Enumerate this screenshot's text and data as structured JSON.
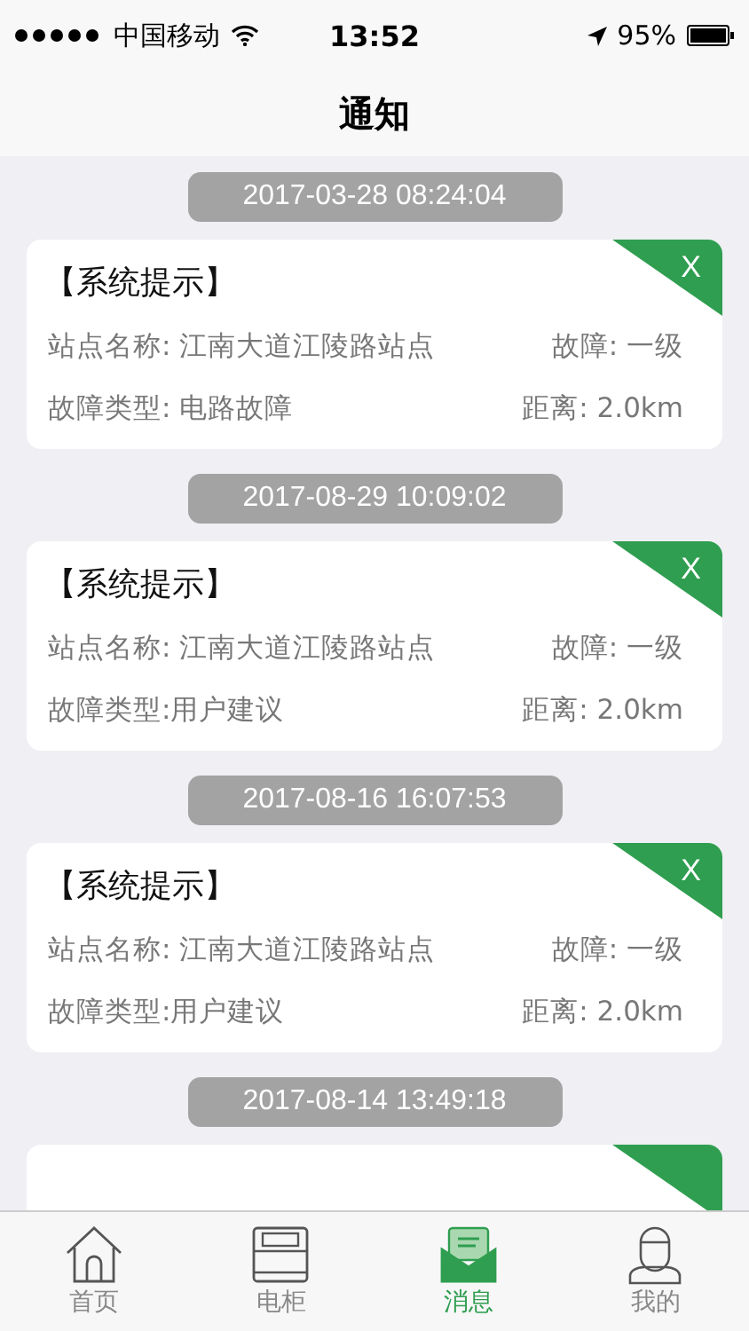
{
  "status_bar": {
    "carrier": "中国移动",
    "time": "13:52",
    "battery": "95%"
  },
  "nav": {
    "title": "通知"
  },
  "notices": [
    {
      "kind": "full",
      "date": "2017-03-28 08:24:04",
      "title": "【系统提示】",
      "station": "站点名称: 江南大道江陵路站点",
      "level": "故障: 一级",
      "type": "故障类型: 电路故障",
      "distance": "距离: 2.0km",
      "close": "X"
    },
    {
      "kind": "full",
      "date": "2017-08-29 10:09:02",
      "title": "【系统提示】",
      "station": "站点名称: 江南大道江陵路站点",
      "level": "故障: 一级",
      "type": "故障类型:用户建议",
      "distance": "距离: 2.0km",
      "close": "X"
    },
    {
      "kind": "full",
      "date": "2017-08-16 16:07:53",
      "title": "【系统提示】",
      "station": "站点名称: 江南大道江陵路站点",
      "level": "故障: 一级",
      "type": "故障类型:用户建议",
      "distance": "距离: 2.0km",
      "close": "X"
    },
    {
      "kind": "clipped",
      "date": "2017-08-14 13:49:18"
    }
  ],
  "tabs": [
    {
      "kind": "home",
      "label": "首页",
      "selected": false
    },
    {
      "kind": "cabinet",
      "label": "电柜",
      "selected": false
    },
    {
      "kind": "message",
      "label": "消息",
      "selected": true
    },
    {
      "kind": "user",
      "label": "我的",
      "selected": false
    }
  ]
}
